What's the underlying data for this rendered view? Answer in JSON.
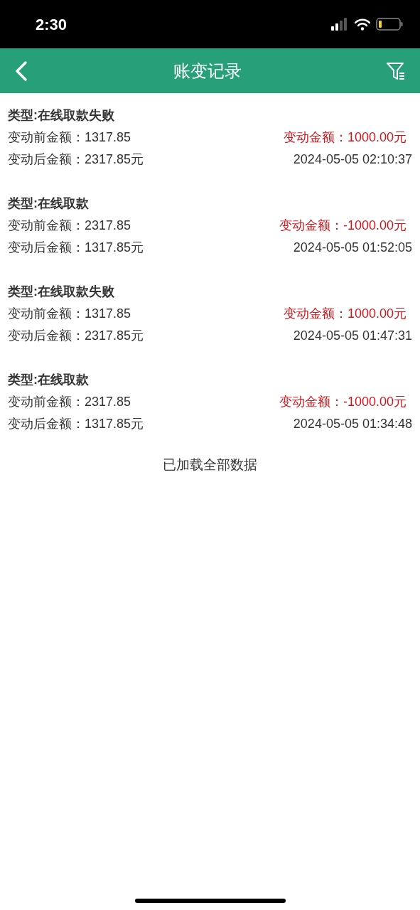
{
  "status_bar": {
    "time": "2:30"
  },
  "header": {
    "title": "账变记录"
  },
  "records": [
    {
      "type": "类型:在线取款失败",
      "before": "变动前金额：1317.85",
      "amount": "变动金额：1000.00元",
      "after": "变动后金额：2317.85元",
      "time": "2024-05-05 02:10:37"
    },
    {
      "type": "类型:在线取款",
      "before": "变动前金额：2317.85",
      "amount": "变动金额：-1000.00元",
      "after": "变动后金额：1317.85元",
      "time": "2024-05-05 01:52:05"
    },
    {
      "type": "类型:在线取款失败",
      "before": "变动前金额：1317.85",
      "amount": "变动金额：1000.00元",
      "after": "变动后金额：2317.85元",
      "time": "2024-05-05 01:47:31"
    },
    {
      "type": "类型:在线取款",
      "before": "变动前金额：2317.85",
      "amount": "变动金额：-1000.00元",
      "after": "变动后金额：1317.85元",
      "time": "2024-05-05 01:34:48"
    }
  ],
  "footer_note": "已加载全部数据"
}
